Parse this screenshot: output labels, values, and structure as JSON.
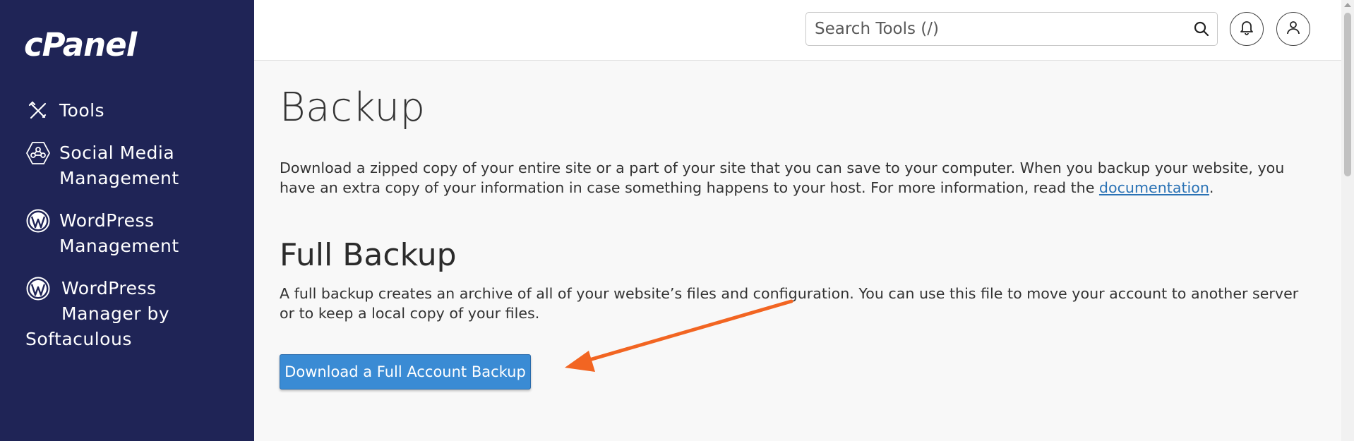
{
  "brand": {
    "logo_text": "cPanel"
  },
  "sidebar": {
    "items": [
      {
        "icon": "tools-icon",
        "line1": "Tools",
        "line2": ""
      },
      {
        "icon": "social-media-icon",
        "line1": "Social Media",
        "line2": "Management"
      },
      {
        "icon": "wordpress-icon",
        "line1": "WordPress",
        "line2": "Management"
      },
      {
        "icon": "wordpress-icon",
        "line1": "WordPress",
        "line2": "Manager by",
        "line3": "Softaculous"
      }
    ]
  },
  "header": {
    "search": {
      "placeholder": "Search Tools (/)"
    },
    "icons": [
      "search-icon",
      "bell-icon",
      "user-icon"
    ]
  },
  "main": {
    "title": "Backup",
    "description": "Download a zipped copy of your entire site or a part of your site that you can save to your computer. When you backup your website, you have an extra copy of your information in case something happens to your host. For more information, read the ",
    "doc_link": "documentation",
    "description_end": ".",
    "full_backup": {
      "title": "Full Backup",
      "description": "A full backup creates an archive of all of your website’s files and configuration. You can use this file to move your account to another server or to keep a local copy of your files.",
      "button_label": "Download a Full Account Backup"
    }
  },
  "colors": {
    "sidebar_bg": "#1f2456",
    "button_bg": "#3a8bd4",
    "link": "#2a72b5",
    "arrow": "#f26522"
  }
}
